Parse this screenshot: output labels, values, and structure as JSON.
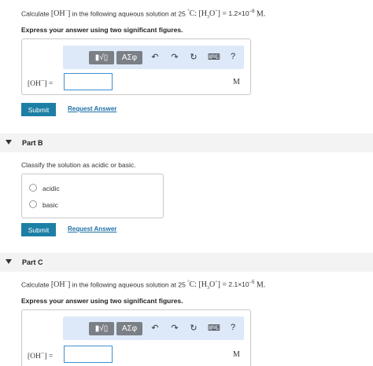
{
  "part_a": {
    "q_prefix": "Calculate",
    "q_species": "[OH",
    "q_species_sup": "−",
    "q_species_close": "]",
    "q_mid": "in the following aqueous solution at 25",
    "q_degree": "°",
    "q_unit_c": "C:",
    "q_h3o": "[H",
    "q_h3o_sub": "3",
    "q_h3o_o": "O",
    "q_h3o_sup": "+",
    "q_h3o_close": "]",
    "q_eq": "=",
    "q_value": "1.2×10",
    "q_exp": "−8",
    "q_m": "M",
    "q_end": ".",
    "instruction": "Express your answer using two significant figures.",
    "answer_label": "[OH",
    "answer_label_sup": "−",
    "answer_label_close": "] =",
    "answer_value": "",
    "unit": "M",
    "submit": "Submit",
    "request": "Request Answer"
  },
  "toolbar": {
    "templates_icon": "▮√▯",
    "greek_label": "ΑΣφ",
    "undo_icon": "↶",
    "redo_icon": "↷",
    "reset_icon": "↻",
    "keyboard_icon": "⌨",
    "help_icon": "?"
  },
  "part_b": {
    "title": "Part B",
    "prompt": "Classify the solution as acidic or basic.",
    "options": [
      "acidic",
      "basic"
    ],
    "submit": "Submit",
    "request": "Request Answer"
  },
  "part_c": {
    "title": "Part C",
    "q_prefix": "Calculate",
    "q_species": "[OH",
    "q_species_sup": "−",
    "q_species_close": "]",
    "q_mid": "in the following aqueous solution at 25",
    "q_degree": "°",
    "q_unit_c": "C:",
    "q_h3o": "[H",
    "q_h3o_sub": "3",
    "q_h3o_o": "O",
    "q_h3o_sup": "+",
    "q_h3o_close": "]",
    "q_eq": "=",
    "q_value": "2.1×10",
    "q_exp": "−5",
    "q_m": "M",
    "q_end": ".",
    "instruction": "Express your answer using two significant figures.",
    "answer_label": "[OH",
    "answer_label_sup": "−",
    "answer_label_close": "] =",
    "answer_value": "",
    "unit": "M"
  },
  "colors": {
    "accent": "#1d7fa5",
    "link": "#1d6fa6",
    "toolbar_bg": "#dde9f8",
    "input_border": "#3f8fcf"
  }
}
